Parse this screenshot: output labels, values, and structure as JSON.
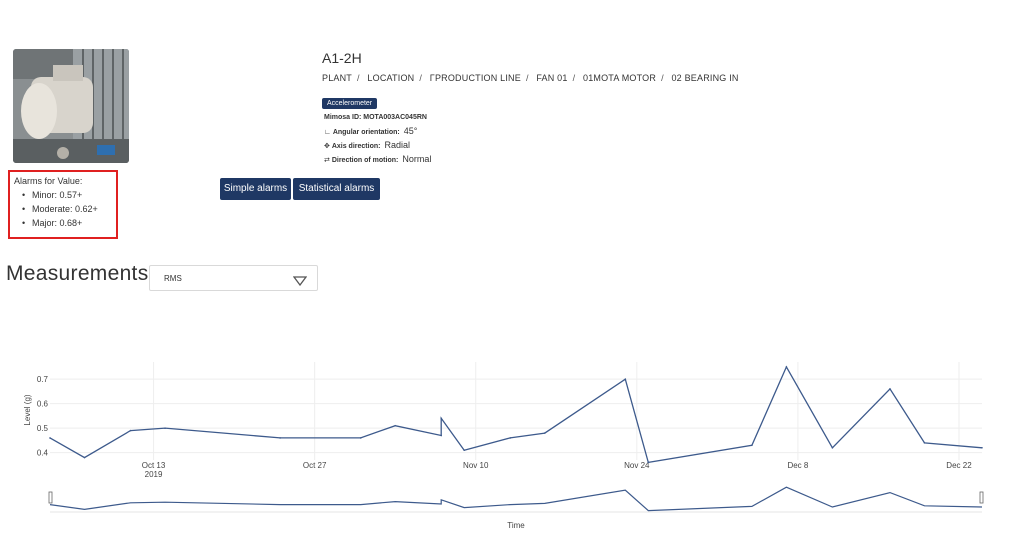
{
  "alarms": {
    "title": "Alarms for Value:",
    "items": [
      "Minor: 0.57+",
      "Moderate: 0.62+",
      "Major: 0.68+"
    ]
  },
  "sensor": {
    "title": "A1-2H",
    "breadcrumb": [
      "PLANT",
      "LOCATION",
      "ΓPRODUCTION LINE",
      "FAN 01",
      "01MOTA MOTOR",
      "02 BEARING IN"
    ],
    "badge": "Accelerometer",
    "mimosa_label": "Mimosa ID: MOTA003AC045RN",
    "angular_label": "Angular orientation:",
    "angular_value": "45°",
    "axis_label": "Axis direction:",
    "axis_value": "Radial",
    "motion_label": "Direction of motion:",
    "motion_value": "Normal"
  },
  "buttons": {
    "simple": "Simple alarms",
    "statistical": "Statistical alarms"
  },
  "measurements": {
    "title": "Measurements",
    "selected": "RMS"
  },
  "colors": {
    "primary": "#1f3864",
    "line": "#3d5a8c",
    "alarm_border": "#e02020"
  },
  "chart_data": {
    "type": "line",
    "ylabel": "Level (g)",
    "xlabel": "Time",
    "ylim": [
      0.37,
      0.77
    ],
    "yticks": [
      0.4,
      0.5,
      0.6,
      0.7
    ],
    "xticks": [
      {
        "date": "2019-10-13",
        "label": "Oct 13",
        "sub": "2019"
      },
      {
        "date": "2019-10-27",
        "label": "Oct 27",
        "sub": ""
      },
      {
        "date": "2019-11-10",
        "label": "Nov 10",
        "sub": ""
      },
      {
        "date": "2019-11-24",
        "label": "Nov 24",
        "sub": ""
      },
      {
        "date": "2019-12-08",
        "label": "Dec 8",
        "sub": ""
      },
      {
        "date": "2019-12-22",
        "label": "Dec 22",
        "sub": ""
      }
    ],
    "xrange": [
      "2019-10-04",
      "2019-12-24"
    ],
    "series": [
      {
        "points": [
          [
            "2019-10-04",
            0.46
          ],
          [
            "2019-10-07",
            0.38
          ],
          [
            "2019-10-11",
            0.49
          ],
          [
            "2019-10-14",
            0.5
          ],
          [
            "2019-10-24",
            0.46
          ],
          [
            "2019-10-31",
            0.46
          ],
          [
            "2019-11-03",
            0.51
          ],
          [
            "2019-11-07",
            0.47
          ],
          [
            "2019-11-07",
            0.54
          ],
          [
            "2019-11-09",
            0.41
          ],
          [
            "2019-11-13",
            0.46
          ],
          [
            "2019-11-16",
            0.48
          ],
          [
            "2019-11-23",
            0.7
          ],
          [
            "2019-11-25",
            0.36
          ],
          [
            "2019-12-04",
            0.43
          ],
          [
            "2019-12-07",
            0.75
          ],
          [
            "2019-12-11",
            0.42
          ],
          [
            "2019-12-16",
            0.66
          ],
          [
            "2019-12-19",
            0.44
          ],
          [
            "2019-12-24",
            0.42
          ]
        ]
      }
    ]
  }
}
